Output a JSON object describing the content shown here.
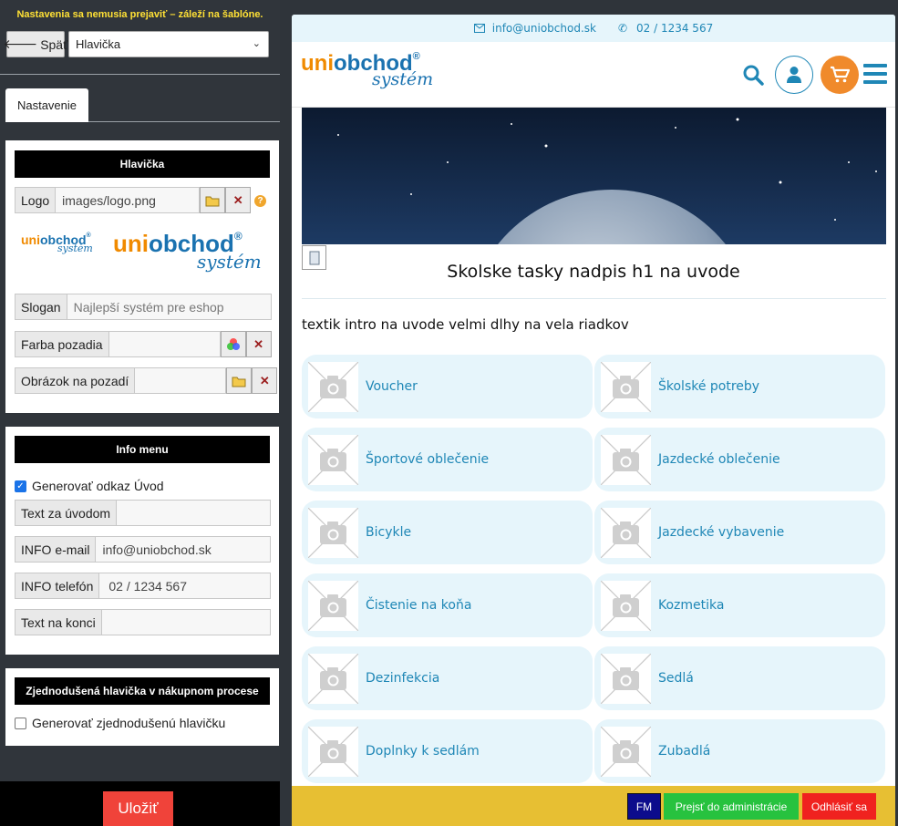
{
  "editor": {
    "notice": "Nastavenia sa nemusia prejaviť – záleží na šablóne.",
    "back_label": "Späť",
    "section_select": "Hlavička",
    "tab_label": "Nastavenie",
    "header_card": {
      "title": "Hlavička",
      "logo_label": "Logo",
      "logo_value": "images/logo.png",
      "slogan_label": "Slogan",
      "slogan_placeholder": "Najlepší systém pre eshop",
      "bg_color_label": "Farba pozadia",
      "bg_image_label": "Obrázok na pozadí"
    },
    "info_card": {
      "title": "Info menu",
      "generate_link_label": "Generovať odkaz Úvod",
      "generate_link_checked": true,
      "text_after_label": "Text za úvodom",
      "email_label": "INFO e-mail",
      "email_value": "info@uniobchod.sk",
      "phone_label": "INFO telefón",
      "phone_value": "02 / 1234 567",
      "end_text_label": "Text na konci"
    },
    "simple_card": {
      "title": "Zjednodušená hlavička v nákupnom procese",
      "generate_simple_label": "Generovať zjednodušenú hlavičku",
      "generate_simple_checked": false
    },
    "save_label": "Uložiť"
  },
  "logo": {
    "part1": "uni",
    "part2": "obchod",
    "reg": "®",
    "script": "systém"
  },
  "preview": {
    "topbar": {
      "email": "info@uniobchod.sk",
      "phone": "02 / 1234 567"
    },
    "heading": "Skolske tasky nadpis h1 na uvode",
    "intro": "textik intro na uvode velmi dlhy na vela riadkov",
    "categories": [
      "Voucher",
      "Školské potreby",
      "Športové oblečenie",
      "Jazdecké oblečenie",
      "Bicykle",
      "Jazdecké vybavenie",
      "Čistenie na koňa",
      "Kozmetika",
      "Dezinfekcia",
      "Sedlá",
      "Doplnky k sedlám",
      "Zubadlá"
    ]
  },
  "admin_bar": {
    "fm": "FM",
    "admin": "Prejsť do administrácie",
    "logout": "Odhlásiť sa"
  },
  "colors": {
    "accent": "#1f87b6",
    "orange": "#f08a2b",
    "save": "#f0433a",
    "admin_bar": "#e7bf33"
  }
}
